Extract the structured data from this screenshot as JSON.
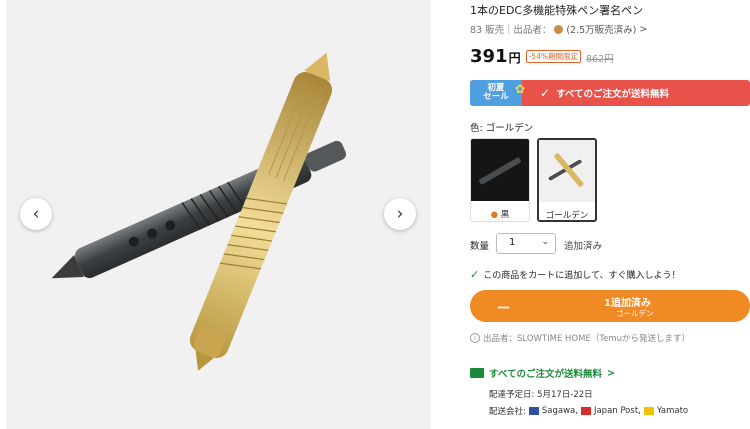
{
  "product": {
    "title": "1本のEDC多機能特殊ペン署名ペン",
    "sold_count": "83 販売",
    "seller_label": "出品者：",
    "seller_sold": "(2.5万販売済み)",
    "seller_chevron": ">",
    "price": "391",
    "price_unit": "円",
    "discount_badge": "-54%期間限定",
    "old_price": "862円"
  },
  "promo": {
    "tag_line1": "初夏",
    "tag_line2": "セール",
    "text": "すべてのご注文が送料無料"
  },
  "color": {
    "label": "色: ゴールデン",
    "options": [
      {
        "label": "黒",
        "selected": false
      },
      {
        "label": "ゴールデン",
        "selected": true
      }
    ]
  },
  "quantity": {
    "label": "数量",
    "value": "1",
    "added": "追加済み"
  },
  "cart": {
    "message": "この商品をカートに追加して、すぐ購入しよう！",
    "button_line1": "1追加済み",
    "button_line2": "ゴールデン",
    "minus": "－"
  },
  "seller_info": "出品者：SLOWTIME HOME（Temuから発送します）",
  "shipping": {
    "title": "すべてのご注文が送料無料",
    "chevron": ">",
    "eta": "配達予定日: 5月17日-22日",
    "carriers_label": "配送会社:",
    "carriers": [
      "Sagawa,",
      "Japan Post,",
      "Yamato"
    ]
  },
  "gallery": {
    "prev": "‹",
    "next": "›"
  },
  "colors": {
    "accent_orange": "#f08a24",
    "promo_red": "#e9524a",
    "promo_blue": "#4f9fe0",
    "ship_green": "#1a8a3a",
    "gold_pen": "#d9b765",
    "black_pen": "#4a4d4f"
  },
  "icons": [
    "chevron-left-icon",
    "chevron-right-icon",
    "check-icon",
    "flower-icon",
    "info-icon",
    "truck-icon",
    "drop-icon",
    "chevron-down-icon"
  ]
}
